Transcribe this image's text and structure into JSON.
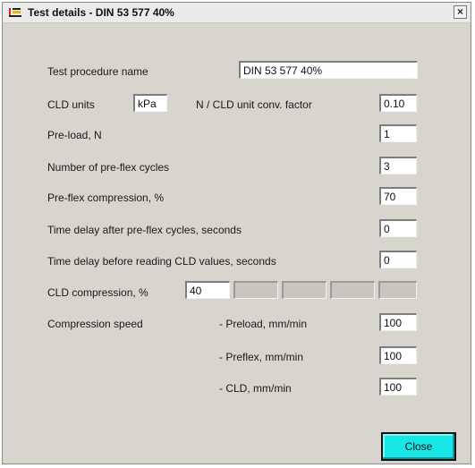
{
  "window": {
    "title": "Test details - DIN 53 577 40%",
    "close_glyph": "×",
    "icon_name": "app-icon"
  },
  "form": {
    "procedure_name_label": "Test procedure name",
    "procedure_name_value": "DIN 53 577 40%",
    "cld_units_label": "CLD units",
    "cld_units_value": "kPa",
    "conv_factor_label": "N / CLD unit conv. factor",
    "conv_factor_value": "0.10",
    "preload_label": "Pre-load, N",
    "preload_value": "1",
    "preflex_cycles_label": "Number of pre-flex cycles",
    "preflex_cycles_value": "3",
    "preflex_compression_label": "Pre-flex compression, %",
    "preflex_compression_value": "70",
    "delay_after_label": "Time delay after pre-flex cycles, seconds",
    "delay_after_value": "0",
    "delay_before_label": "Time delay before reading CLD values, seconds",
    "delay_before_value": "0",
    "cld_compression_label": "CLD compression, %",
    "cld_compression_values": [
      "40",
      "",
      "",
      "",
      ""
    ],
    "speed_label": "Compression speed",
    "speed_preload_label": "- Preload, mm/min",
    "speed_preload_value": "100",
    "speed_preflex_label": "- Preflex, mm/min",
    "speed_preflex_value": "100",
    "speed_cld_label": "- CLD, mm/min",
    "speed_cld_value": "100"
  },
  "buttons": {
    "close_label": "Close"
  },
  "colors": {
    "close_button": "#19e6e6",
    "window_bg": "#d8d4ce"
  }
}
